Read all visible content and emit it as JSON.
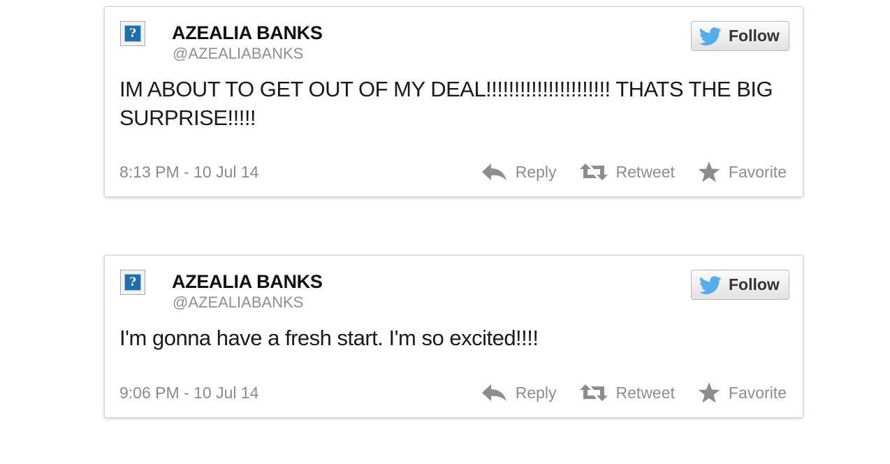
{
  "colors": {
    "accent_blue": "#55acee",
    "avatar_blue": "#1f6fa8",
    "text": "#1a1a1a",
    "muted": "#8a8a8a",
    "border": "#d6d6d6"
  },
  "icons": {
    "avatar": "broken-image-question-icon",
    "follow": "twitter-bird-icon",
    "reply": "reply-arrow-icon",
    "retweet": "retweet-icon",
    "favorite": "star-icon"
  },
  "tweets": [
    {
      "name": "AZEALIA BANKS",
      "handle": "@AZEALIABANKS",
      "follow_label": "Follow",
      "avatar_glyph": "?",
      "text": "IM ABOUT TO GET OUT OF MY DEAL!!!!!!!!!!!!!!!!!!!!!! THATS THE BIG SURPRISE!!!!!",
      "timestamp": "8:13 PM - 10 Jul 14",
      "actions": {
        "reply": "Reply",
        "retweet": "Retweet",
        "favorite": "Favorite"
      }
    },
    {
      "name": "AZEALIA BANKS",
      "handle": "@AZEALIABANKS",
      "follow_label": "Follow",
      "avatar_glyph": "?",
      "text": "I'm gonna have a fresh start. I'm so excited!!!!",
      "timestamp": "9:06 PM - 10 Jul 14",
      "actions": {
        "reply": "Reply",
        "retweet": "Retweet",
        "favorite": "Favorite"
      }
    }
  ]
}
